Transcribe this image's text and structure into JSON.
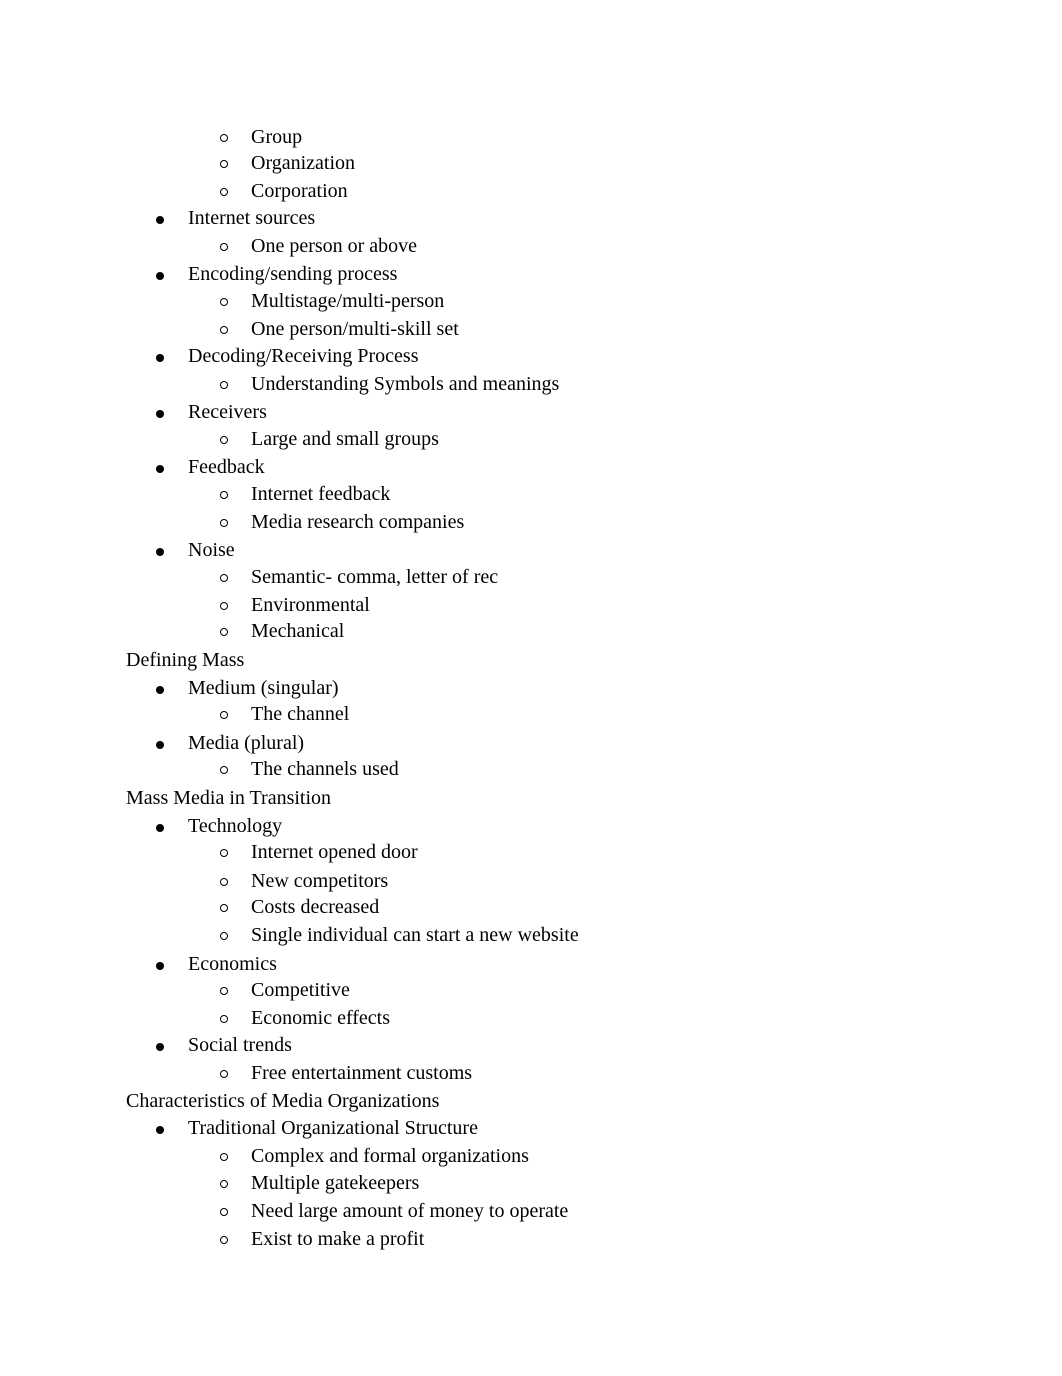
{
  "document": {
    "lines": [
      {
        "level": 2,
        "text": "Group"
      },
      {
        "level": 2,
        "text": "Organization"
      },
      {
        "level": 2,
        "text": "Corporation"
      },
      {
        "level": 1,
        "text": "Internet sources"
      },
      {
        "level": 2,
        "text": "One person or above"
      },
      {
        "level": 1,
        "text": "Encoding/sending process"
      },
      {
        "level": 2,
        "text": "Multistage/multi-person"
      },
      {
        "level": 2,
        "text": "One person/multi-skill set"
      },
      {
        "level": 1,
        "text": "Decoding/Receiving Process"
      },
      {
        "level": 2,
        "text": "Understanding Symbols and meanings"
      },
      {
        "level": 1,
        "text": "Receivers"
      },
      {
        "level": 2,
        "text": "Large and small groups"
      },
      {
        "level": 1,
        "text": "Feedback"
      },
      {
        "level": 2,
        "text": "Internet feedback"
      },
      {
        "level": 2,
        "text": "Media research companies"
      },
      {
        "level": 1,
        "text": "Noise"
      },
      {
        "level": 2,
        "text": "Semantic- comma, letter of rec"
      },
      {
        "level": 2,
        "text": "Environmental"
      },
      {
        "level": 2,
        "text": "Mechanical"
      },
      {
        "level": 0,
        "text": "Defining Mass"
      },
      {
        "level": 1,
        "text": "Medium (singular)"
      },
      {
        "level": 2,
        "text": "The channel"
      },
      {
        "level": 1,
        "text": "Media (plural)"
      },
      {
        "level": 2,
        "text": "The channels used"
      },
      {
        "level": 0,
        "text": "Mass Media in Transition"
      },
      {
        "level": 1,
        "text": "Technology"
      },
      {
        "level": 2,
        "text": "Internet opened door"
      },
      {
        "level": 2,
        "text": "New competitors"
      },
      {
        "level": 2,
        "text": "Costs decreased"
      },
      {
        "level": 2,
        "text": "Single individual can start a new website"
      },
      {
        "level": 1,
        "text": "Economics"
      },
      {
        "level": 2,
        "text": "Competitive"
      },
      {
        "level": 2,
        "text": "Economic effects"
      },
      {
        "level": 1,
        "text": "Social trends"
      },
      {
        "level": 2,
        "text": "Free entertainment customs"
      },
      {
        "level": 0,
        "text": "Characteristics of Media Organizations"
      },
      {
        "level": 1,
        "text": "Traditional Organizational Structure"
      },
      {
        "level": 2,
        "text": "Complex and formal organizations"
      },
      {
        "level": 2,
        "text": "Multiple gatekeepers"
      },
      {
        "level": 2,
        "text": "Need large amount of money to operate"
      },
      {
        "level": 2,
        "text": "Exist to make a profit"
      }
    ]
  }
}
